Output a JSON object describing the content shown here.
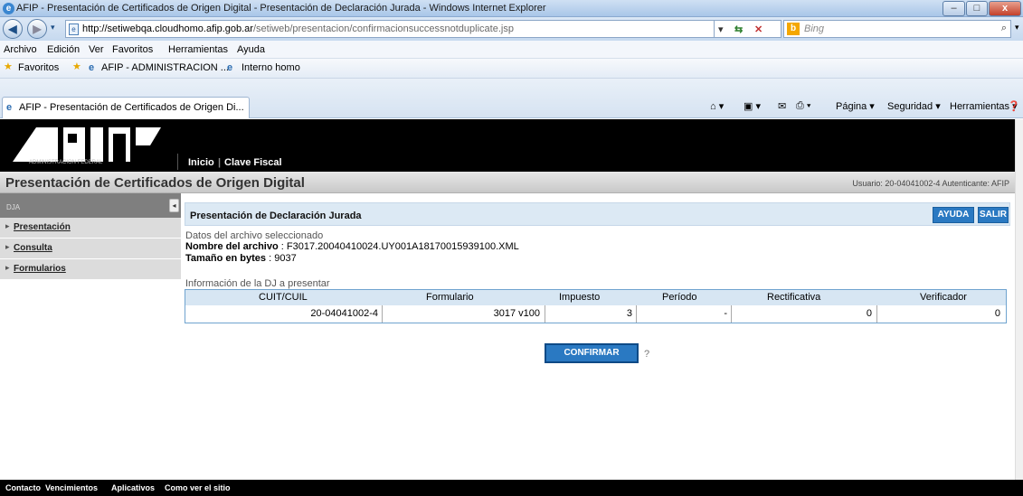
{
  "browser": {
    "title": "AFIP - Presentación de Certificados de Origen Digital - Presentación de Declaración Jurada - Windows Internet Explorer",
    "url_host": "http://setiwebqa.cloudhomo.afip.gob.ar",
    "url_path": "/setiweb/presentacion/confirmacionsuccessnotduplicate.jsp",
    "search_placeholder": "Bing",
    "menu": [
      "Archivo",
      "Edición",
      "Ver",
      "Favoritos",
      "Herramientas",
      "Ayuda"
    ],
    "favorites_label": "Favoritos",
    "fav_links": [
      "AFIP - ADMINISTRACION ...",
      "Interno homo"
    ],
    "tab_label": "AFIP - Presentación de Certificados de Origen Di...",
    "tools": [
      "Página ▾",
      "Seguridad ▾",
      "Herramientas ▾"
    ]
  },
  "site": {
    "logo_text": "ADMINISTRACION FEDERAL",
    "nav": [
      "Inicio",
      "Clave Fiscal"
    ],
    "page_title": "Presentación de Certificados de Origen Digital",
    "user_info": "Usuario: 20-04041002-4 Autenticante: AFIP"
  },
  "sidebar": {
    "header": "DJA",
    "items": [
      "Presentación",
      "Consulta",
      "Formularios"
    ]
  },
  "content": {
    "section_title": "Presentación de Declaración Jurada",
    "help_label": "AYUDA",
    "exit_label": "SALIR",
    "file_header": "Datos del archivo seleccionado",
    "file_name_label": "Nombre del archivo",
    "file_name_value": ": F3017.20040410024.UY001A18170015939100.XML",
    "file_size_label": "Tamaño en bytes",
    "file_size_value": ": 9037",
    "dj_header": "Información de la DJ a presentar",
    "table": {
      "columns": [
        "CUIT/CUIL",
        "Formulario",
        "Impuesto",
        "Período",
        "Rectificativa",
        "Verificador"
      ],
      "row": [
        "20-04041002-4",
        "3017 v100",
        "3",
        "-",
        "0",
        "0"
      ]
    },
    "confirm_label": "CONFIRMAR",
    "help_mark": "?"
  },
  "footer": [
    "Contacto",
    "Vencimientos",
    "Aplicativos",
    "Como ver el sitio"
  ]
}
